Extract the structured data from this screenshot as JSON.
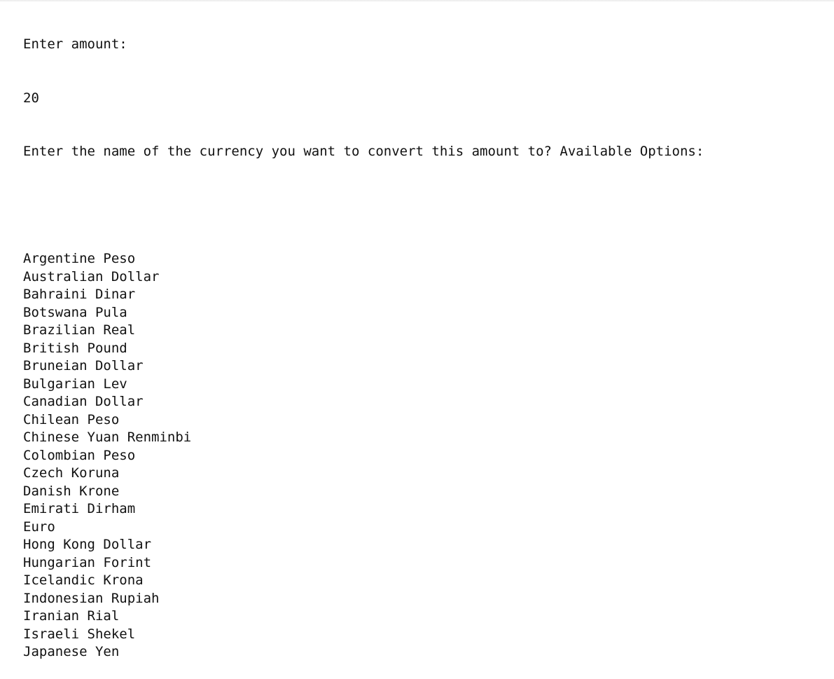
{
  "console": {
    "prompt_amount": "Enter amount:",
    "amount_value": "20",
    "prompt_currency": "Enter the name of the currency you want to convert this amount to? Available Options:",
    "currency_options": [
      "Argentine Peso",
      "Australian Dollar",
      "Bahraini Dinar",
      "Botswana Pula",
      "Brazilian Real",
      "British Pound",
      "Bruneian Dollar",
      "Bulgarian Lev",
      "Canadian Dollar",
      "Chilean Peso",
      "Chinese Yuan Renminbi",
      "Colombian Peso",
      "Czech Koruna",
      "Danish Krone",
      "Emirati Dirham",
      "Euro",
      "Hong Kong Dollar",
      "Hungarian Forint",
      "Icelandic Krona",
      "Indonesian Rupiah",
      "Iranian Rial",
      "Israeli Shekel",
      "Japanese Yen"
    ]
  }
}
